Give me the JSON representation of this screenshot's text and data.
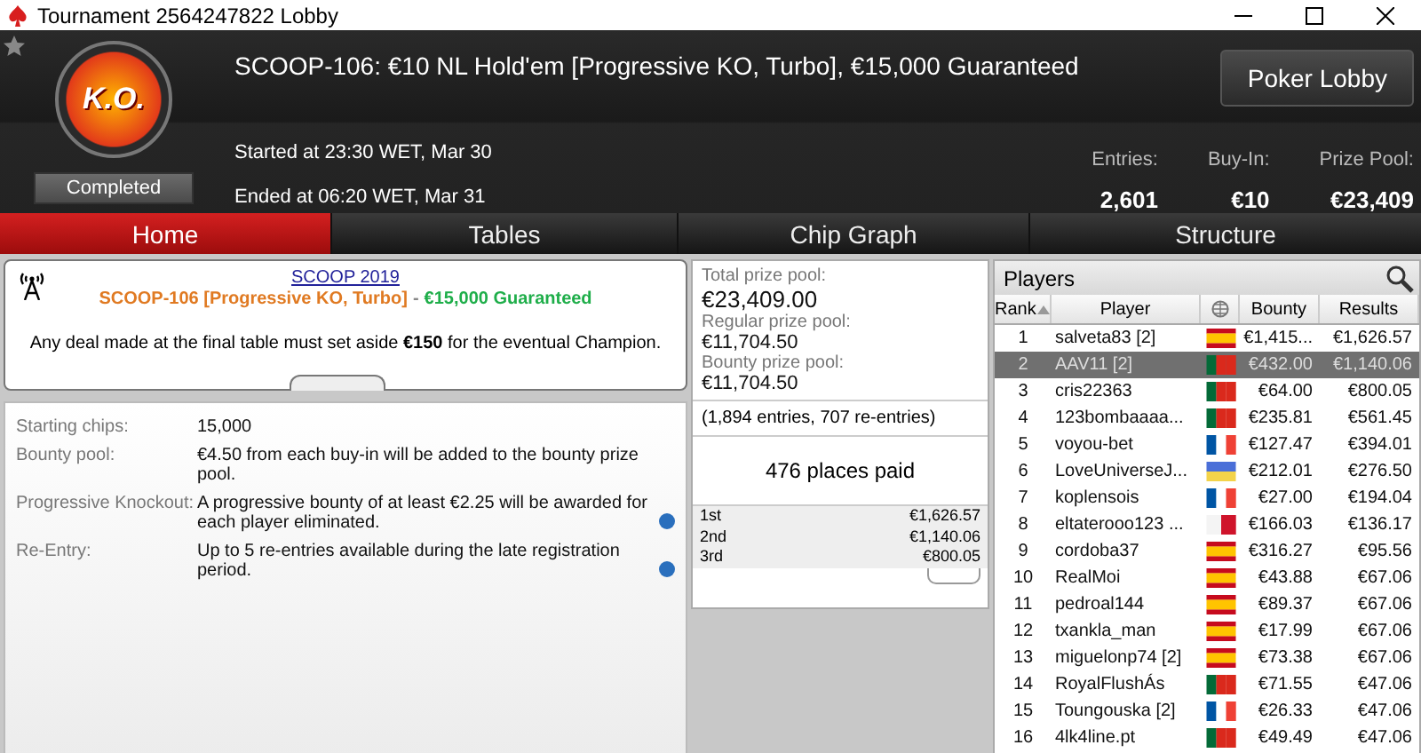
{
  "window": {
    "title": "Tournament 2564247822 Lobby"
  },
  "header": {
    "logo_text": "K.O.",
    "status": "Completed",
    "title": "SCOOP-106: €10 NL Hold'em [Progressive KO, Turbo], €15,000 Guaranteed",
    "started": "Started at 23:30 WET, Mar 30",
    "ended": "Ended at 06:20 WET, Mar 31",
    "lobby_button": "Poker Lobby",
    "stats": [
      {
        "label": "Entries:",
        "value": "2,601"
      },
      {
        "label": "Buy-In:",
        "value": "€10"
      },
      {
        "label": "Prize Pool:",
        "value": "€23,409"
      }
    ]
  },
  "tabs": [
    {
      "label": "Home",
      "selected": true
    },
    {
      "label": "Tables",
      "selected": false
    },
    {
      "label": "Chip Graph",
      "selected": false
    },
    {
      "label": "Structure",
      "selected": false
    }
  ],
  "news": {
    "link": "SCOOP 2019",
    "event": "SCOOP-106 [Progressive KO, Turbo]",
    "separator": "-",
    "guarantee": "€15,000 Guaranteed",
    "notice": "Any deal made at the final table must set aside **€150** for the eventual Champion."
  },
  "details": [
    {
      "label": "Starting chips:",
      "value": "15,000",
      "info": false
    },
    {
      "label": "Bounty pool:",
      "value": "€4.50 from each buy-in will be added to the bounty prize pool.",
      "info": false
    },
    {
      "label": "Progressive Knockout:",
      "value": "A progressive bounty of at least €2.25 will be awarded for each player eliminated.",
      "info": true
    },
    {
      "label": "Re-Entry:",
      "value": "Up to 5 re-entries available during the late registration period.",
      "info": true
    }
  ],
  "prizes": {
    "pools": [
      {
        "label": "Total prize pool:",
        "value": "€23,409.00"
      },
      {
        "label": "Regular prize pool:",
        "value": "€11,704.50"
      },
      {
        "label": "Bounty prize pool:",
        "value": "€11,704.50"
      }
    ],
    "entries_note": "(1,894 entries, 707 re-entries)",
    "places_paid": "476 places paid",
    "payouts": [
      {
        "place": "1st",
        "amount": "€1,626.57"
      },
      {
        "place": "2nd",
        "amount": "€1,140.06"
      },
      {
        "place": "3rd",
        "amount": "€800.05"
      }
    ]
  },
  "players": {
    "title": "Players",
    "columns": [
      "Rank",
      "Player",
      "Bounty",
      "Results"
    ],
    "rows": [
      {
        "rank": "1",
        "player": "salveta83 [2]",
        "color": "#c60b1e",
        "bounty": "€1,415...",
        "results": "€1,626.57",
        "selected": false
      },
      {
        "rank": "2",
        "player": "AAV11 [2]",
        "color": "#046a38",
        "bounty": "€432.00",
        "results": "€1,140.06",
        "selected": true
      },
      {
        "rank": "3",
        "player": "cris22363",
        "color": "#046a38",
        "bounty": "€64.00",
        "results": "€800.05",
        "selected": false
      },
      {
        "rank": "4",
        "player": "123bombaaaa...",
        "color": "#046a38",
        "bounty": "€235.81",
        "results": "€561.45",
        "selected": false
      },
      {
        "rank": "5",
        "player": "voyou-bet",
        "color": "#0055a4",
        "bounty": "€127.47",
        "results": "€394.01",
        "selected": false
      },
      {
        "rank": "6",
        "player": "LoveUniverseJ...",
        "color": "#4a6fd8",
        "bounty": "€212.01",
        "results": "€276.50",
        "selected": false
      },
      {
        "rank": "7",
        "player": "koplensois",
        "color": "#0055a4",
        "bounty": "€27.00",
        "results": "€194.04",
        "selected": false
      },
      {
        "rank": "8",
        "player": "eltaterooo123 ...",
        "color": "#cf142b",
        "bounty": "€166.03",
        "results": "€136.17",
        "selected": false
      },
      {
        "rank": "9",
        "player": "cordoba37",
        "color": "#c60b1e",
        "bounty": "€316.27",
        "results": "€95.56",
        "selected": false
      },
      {
        "rank": "10",
        "player": "RealMoi",
        "color": "#c60b1e",
        "bounty": "€43.88",
        "results": "€67.06",
        "selected": false
      },
      {
        "rank": "11",
        "player": "pedroal144",
        "color": "#c60b1e",
        "bounty": "€89.37",
        "results": "€67.06",
        "selected": false
      },
      {
        "rank": "12",
        "player": "txankla_man",
        "color": "#c60b1e",
        "bounty": "€17.99",
        "results": "€67.06",
        "selected": false
      },
      {
        "rank": "13",
        "player": "miguelonp74 [2]",
        "color": "#c60b1e",
        "bounty": "€73.38",
        "results": "€67.06",
        "selected": false
      },
      {
        "rank": "14",
        "player": "RoyalFlushÁs",
        "color": "#046a38",
        "bounty": "€71.55",
        "results": "€47.06",
        "selected": false
      },
      {
        "rank": "15",
        "player": "Toungouska [2]",
        "color": "#0055a4",
        "bounty": "€26.33",
        "results": "€47.06",
        "selected": false
      },
      {
        "rank": "16",
        "player": "4lk4line.pt",
        "color": "#046a38",
        "bounty": "€49.49",
        "results": "€47.06",
        "selected": false
      }
    ]
  }
}
